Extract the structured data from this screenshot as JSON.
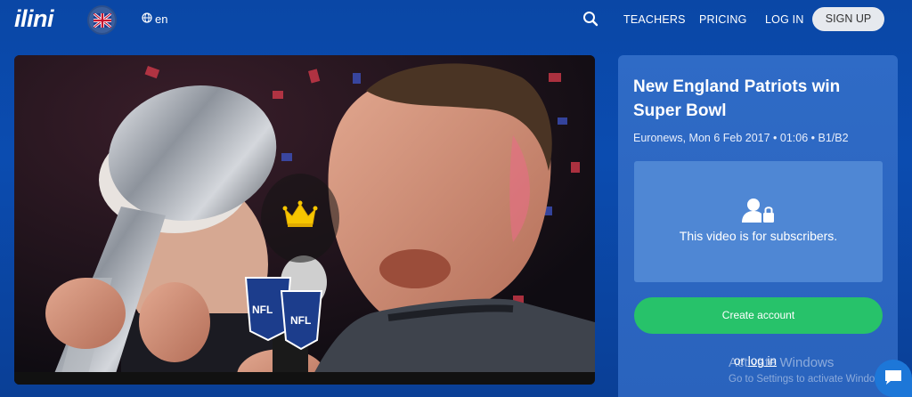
{
  "nav": {
    "logo": "ilini",
    "language": "en",
    "links": [
      "TEACHERS",
      "PRICING",
      "LOG IN"
    ],
    "signup": "SIGN UP"
  },
  "video": {
    "microphone_text": "NFL"
  },
  "panel": {
    "title": "New England Patriots win Super Bowl",
    "meta": "Euronews, Mon 6 Feb 2017 • 01:06 • B1/B2",
    "locked_message": "This video is for subscribers.",
    "create_account": "Create account",
    "or_text": "or ",
    "login_link": "log in"
  },
  "watermark": {
    "line1": "Activate Windows",
    "line2": "Go to Settings to activate Windows."
  },
  "colors": {
    "background": "#0a47a6",
    "panel": "#2f6bc6",
    "locked_box": "#4f87d4",
    "create_button": "#27c26a",
    "crown": "#f7c600"
  }
}
